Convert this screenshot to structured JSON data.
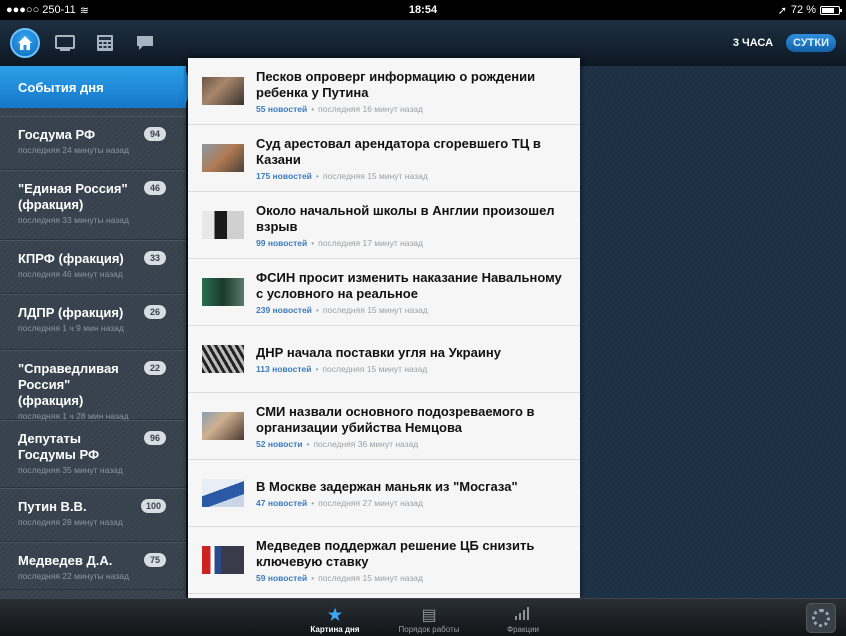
{
  "status": {
    "carrier": "●●●○○ 250-11",
    "time": "18:54",
    "battery": "72 %"
  },
  "topbar": {
    "nav": [
      {
        "name": "home-icon",
        "glyph": "⌂"
      },
      {
        "name": "tv-icon",
        "glyph": "▭"
      },
      {
        "name": "calculator-icon",
        "glyph": "▦"
      },
      {
        "name": "chat-icon",
        "glyph": "▬"
      }
    ],
    "period": {
      "option1": "3 ЧАСА",
      "option2": "СУТКИ"
    }
  },
  "sidebar": {
    "active": "События дня",
    "items": [
      {
        "title": "Госдума РФ",
        "sub": "последняя 24 минуты назад",
        "count": "94"
      },
      {
        "title": "\"Единая Россия\" (фракция)",
        "sub": "последняя 33 минуты назад",
        "count": "46"
      },
      {
        "title": "КПРФ (фракция)",
        "sub": "последняя 46 минут назад",
        "count": "33"
      },
      {
        "title": "ЛДПР (фракция)",
        "sub": "последняя 1 ч 9 мин назад",
        "count": "26"
      },
      {
        "title": "\"Справедливая Россия\" (фракция)",
        "sub": "последняя 1 ч 28 мин назад",
        "count": "22"
      },
      {
        "title": "Депутаты Госдумы РФ",
        "sub": "последняя 35 минут назад",
        "count": "96"
      },
      {
        "title": "Путин В.В.",
        "sub": "последняя 28 минут назад",
        "count": "100"
      },
      {
        "title": "Медведев Д.А.",
        "sub": "последняя 22 минуты назад",
        "count": "75"
      }
    ]
  },
  "news": [
    {
      "title": "Песков опроверг информацию о рождении ребенка у Путина",
      "count": "55 новостей",
      "time": "последняя 16 минут назад"
    },
    {
      "title": "Суд арестовал арендатора сгоревшего ТЦ в Казани",
      "count": "175 новостей",
      "time": "последняя 15 минут назад"
    },
    {
      "title": "Около начальной школы в Англии произошел взрыв",
      "count": "99 новостей",
      "time": "последняя 17 минут назад"
    },
    {
      "title": "ФСИН просит изменить наказание Навальному с условного на реальное",
      "count": "239 новостей",
      "time": "последняя 15 минут назад"
    },
    {
      "title": "ДНР начала поставки угля на Украину",
      "count": "113 новостей",
      "time": "последняя 15 минут назад"
    },
    {
      "title": "СМИ назвали основного подозреваемого в организации убийства Немцова",
      "count": "52 новости",
      "time": "последняя 36 минут назад"
    },
    {
      "title": "В Москве задержан маньяк из \"Мосгаза\"",
      "count": "47 новостей",
      "time": "последняя 27 минут назад"
    },
    {
      "title": "Медведев поддержал решение ЦБ снизить ключевую ставку",
      "count": "59 новостей",
      "time": "последняя 15 минут назад"
    }
  ],
  "tabbar": {
    "tabs": [
      {
        "label": "Картина дня",
        "icon": "star-icon"
      },
      {
        "label": "Порядок работы",
        "icon": "document-icon"
      },
      {
        "label": "Фракции",
        "icon": "bars-icon"
      }
    ]
  },
  "colors": {
    "accent": "#2da1ea",
    "link": "#3b7bbf"
  }
}
